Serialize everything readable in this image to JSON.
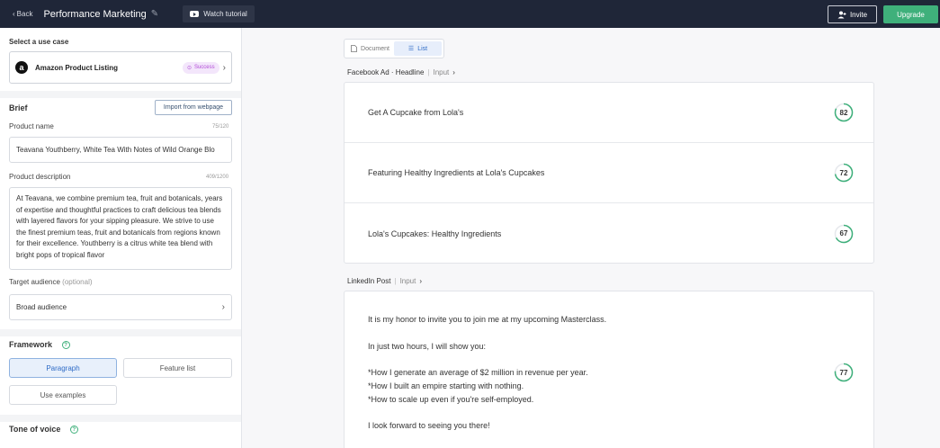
{
  "topbar": {
    "back_label": "Back",
    "title": "Performance Marketing",
    "watch_label": "Watch tutorial",
    "invite_label": "Invite",
    "upgrade_label": "Upgrade"
  },
  "sidebar": {
    "use_case_heading": "Select a use case",
    "use_case": {
      "name": "Amazon Product Listing",
      "badge": "Success"
    },
    "brief_heading": "Brief",
    "import_label": "Import from webpage",
    "product_name": {
      "label": "Product name",
      "count": "75/120",
      "value": "Teavana Youthberry, White Tea With Notes of Wild Orange Blo"
    },
    "product_description": {
      "label": "Product description",
      "count": "409/1200",
      "value": "At Teavana, we combine premium tea, fruit and botanicals, years of expertise and thoughtful practices to craft delicious tea blends with layered flavors for your sipping pleasure. We strive to use the finest premium teas, fruit and botanicals from regions known for their excellence. Youthberry is a citrus white tea blend with bright pops of tropical flavor"
    },
    "target_audience": {
      "label": "Target audience",
      "optional": "(optional)",
      "value": "Broad audience"
    },
    "framework": {
      "heading": "Framework",
      "options": [
        "Paragraph",
        "Feature list",
        "Use examples"
      ],
      "selected": "Paragraph"
    },
    "tone_heading": "Tone of voice"
  },
  "main": {
    "view_toggle": {
      "document": "Document",
      "list": "List"
    },
    "sections": [
      {
        "crumb_main": "Facebook Ad · Headline",
        "crumb_input": "Input",
        "results": [
          {
            "text": "Get A Cupcake from Lola's",
            "score": 82
          },
          {
            "text": "Featuring Healthy Ingredients at Lola's Cupcakes",
            "score": 72
          },
          {
            "text": "Lola's Cupcakes: Healthy Ingredients",
            "score": 67
          }
        ]
      },
      {
        "crumb_main": "LinkedIn Post",
        "crumb_input": "Input",
        "results": [
          {
            "lines": [
              "It is my honor to invite you to join me at my upcoming Masterclass.",
              "",
              "In just two hours, I will show you:",
              "",
              "*How I generate an average of $2 million in revenue per year.",
              "*How I built an empire starting with nothing.",
              "*How to scale up even if you're self-employed.",
              "",
              "I look forward to seeing you there!"
            ],
            "score": 77
          }
        ]
      }
    ]
  },
  "colors": {
    "score_ring": "#3fb07b",
    "accent": "#2e6bc6",
    "upgrade": "#3fb07b",
    "topbar": "#1f2638"
  }
}
